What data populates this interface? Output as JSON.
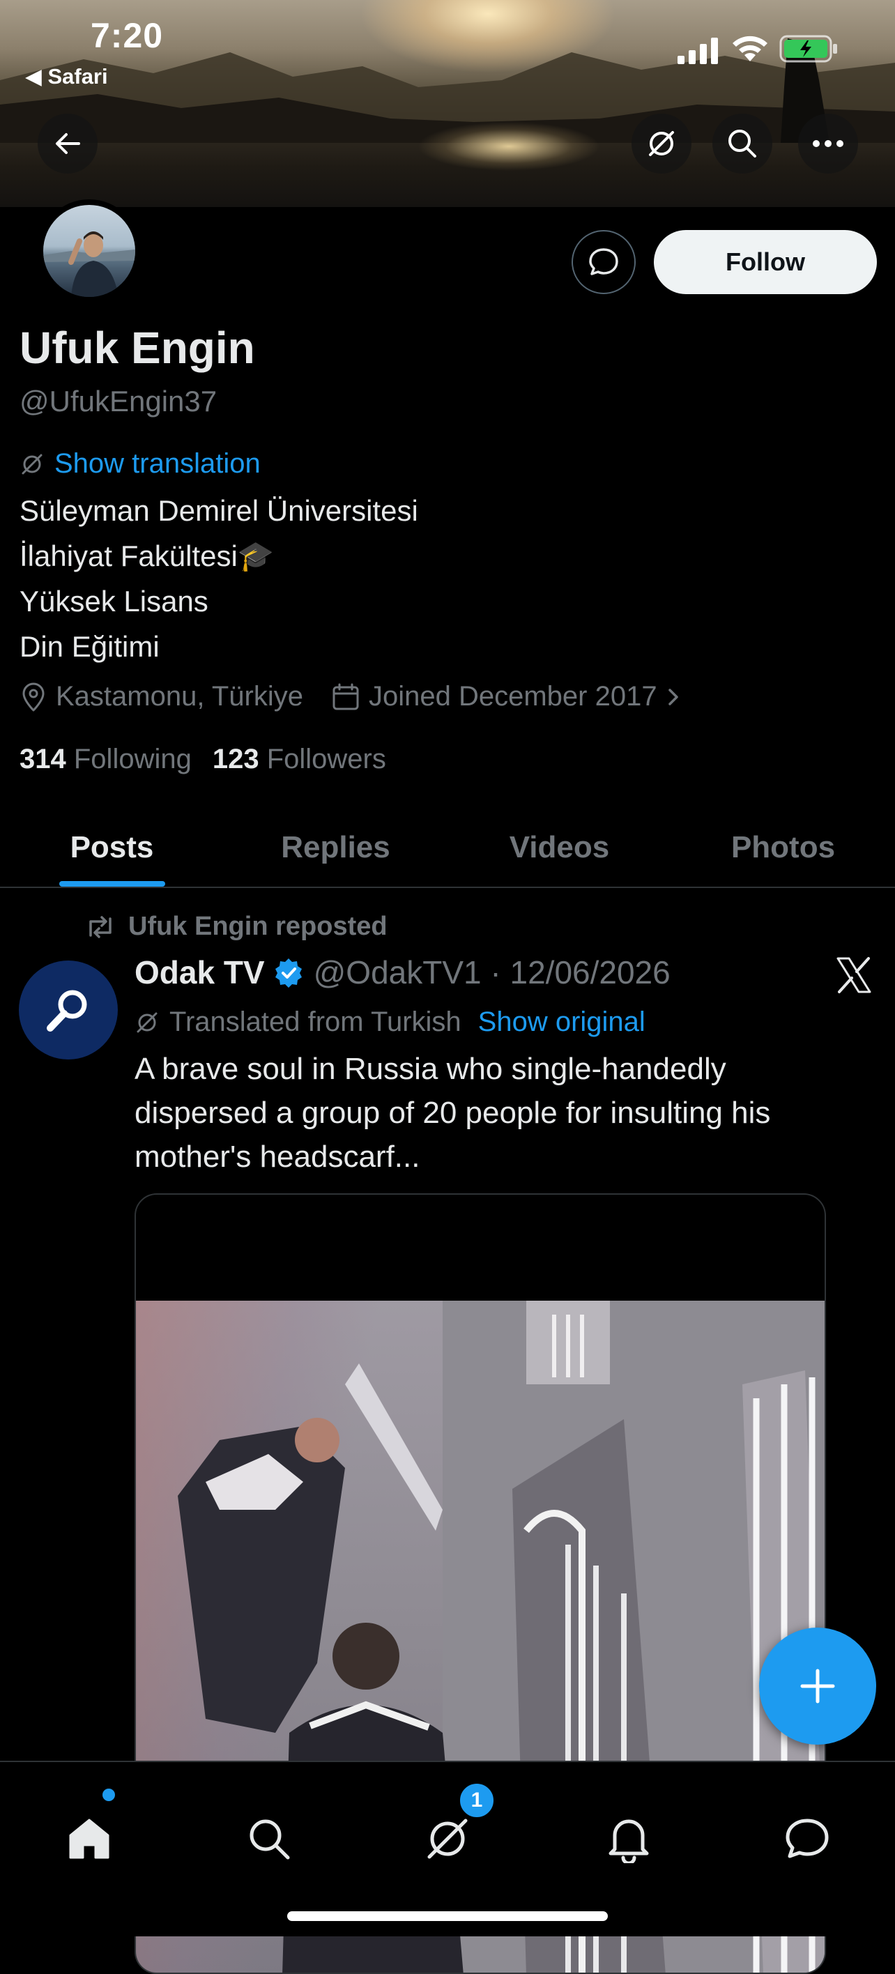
{
  "status_bar": {
    "time": "7:20",
    "back_app": "◀ Safari"
  },
  "banner": {
    "icons": [
      "back-arrow-icon",
      "translate-icon",
      "search-icon",
      "more-icon"
    ]
  },
  "profile": {
    "follow_label": "Follow",
    "name": "Ufuk Engin",
    "handle": "@UfukEngin37",
    "show_translation": "Show translation",
    "bio_lines": [
      "Süleyman Demirel Üniversitesi",
      "İlahiyat Fakültesi🎓",
      "Yüksek Lisans",
      "Din Eğitimi"
    ],
    "location": "Kastamonu, Türkiye",
    "joined": "Joined December 2017",
    "following_count": "314",
    "following_label": "Following",
    "followers_count": "123",
    "followers_label": "Followers"
  },
  "tabs": [
    {
      "label": "Posts",
      "active": true
    },
    {
      "label": "Replies",
      "active": false
    },
    {
      "label": "Videos",
      "active": false
    },
    {
      "label": "Photos",
      "active": false
    }
  ],
  "post": {
    "reposted_by": "Ufuk Engin reposted",
    "author_name": "Odak TV",
    "author_handle": "@OdakTV1 · 12/06/2026",
    "translated_from": "Translated from Turkish",
    "show_original": "Show original",
    "text": "A brave soul in Russia who single-handedly dispersed a group of 20 people for insulting his mother's headscarf..."
  },
  "bottom_nav": {
    "messages_badge": "1",
    "items": [
      "home-icon",
      "search-icon",
      "grok-icon",
      "notifications-icon",
      "messages-icon"
    ]
  },
  "colors": {
    "accent": "#1d9bf0",
    "background": "#000000",
    "text_primary": "#e7e9ea",
    "text_secondary": "#71767b",
    "verified": "#1d9bf0"
  }
}
